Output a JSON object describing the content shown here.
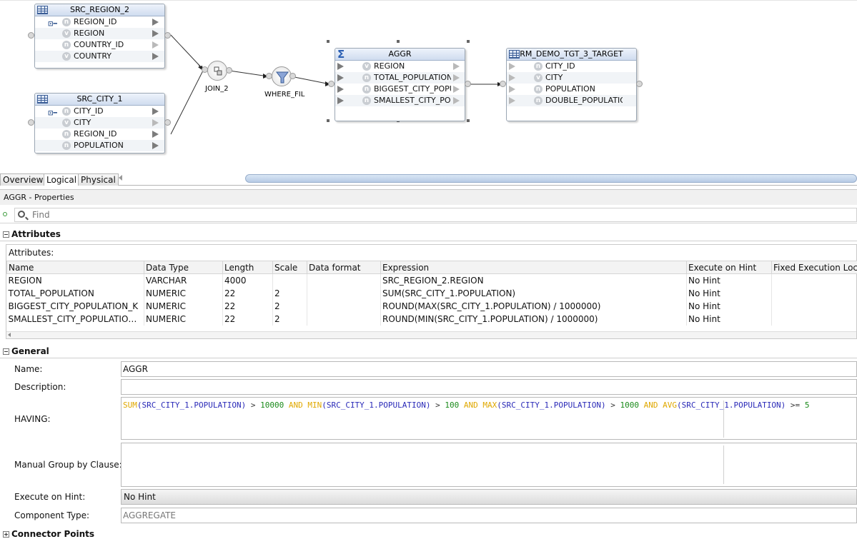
{
  "diagram": {
    "src_region": {
      "title": "SRC_REGION_2",
      "attrs": [
        {
          "name": "REGION_ID",
          "type_glyph": "n",
          "key": true,
          "arrow": "filled"
        },
        {
          "name": "REGION",
          "type_glyph": "v",
          "key": false,
          "arrow": "filled"
        },
        {
          "name": "COUNTRY_ID",
          "type_glyph": "n",
          "key": false,
          "arrow": "hollow"
        },
        {
          "name": "COUNTRY",
          "type_glyph": "v",
          "key": false,
          "arrow": "filled"
        }
      ]
    },
    "src_city": {
      "title": "SRC_CITY_1",
      "attrs": [
        {
          "name": "CITY_ID",
          "type_glyph": "n",
          "key": true,
          "arrow": "filled"
        },
        {
          "name": "CITY",
          "type_glyph": "v",
          "key": false,
          "arrow": "hollow"
        },
        {
          "name": "REGION_ID",
          "type_glyph": "n",
          "key": false,
          "arrow": "filled"
        },
        {
          "name": "POPULATION",
          "type_glyph": "n",
          "key": false,
          "arrow": "filled"
        }
      ]
    },
    "join": {
      "label": "JOIN_2"
    },
    "filter": {
      "label": "WHERE_FIL"
    },
    "aggr": {
      "title": "AGGR",
      "attrs": [
        {
          "name": "REGION",
          "type_glyph": "v"
        },
        {
          "name": "TOTAL_POPULATION",
          "type_glyph": "n"
        },
        {
          "name": "BIGGEST_CITY_POPU",
          "type_glyph": "n"
        },
        {
          "name": "SMALLEST_CITY_POP",
          "type_glyph": "n"
        }
      ]
    },
    "target": {
      "title": "RM_DEMO_TGT_3_TARGET",
      "attrs": [
        {
          "name": "CITY_ID",
          "type_glyph": "n"
        },
        {
          "name": "CITY",
          "type_glyph": "v"
        },
        {
          "name": "POPULATION",
          "type_glyph": "n"
        },
        {
          "name": "DOUBLE_POPULATION",
          "type_glyph": "n"
        }
      ]
    }
  },
  "tabs": [
    {
      "label": "Overview",
      "active": false
    },
    {
      "label": "Logical",
      "active": true
    },
    {
      "label": "Physical",
      "active": false
    }
  ],
  "properties": {
    "title": "AGGR - Properties",
    "find_placeholder": "Find"
  },
  "attributes_section": {
    "header": "Attributes",
    "caption": "Attributes:",
    "columns": [
      "Name",
      "Data Type",
      "Length",
      "Scale",
      "Data format",
      "Expression",
      "Execute on Hint",
      "Fixed Execution Loca"
    ],
    "rows": [
      [
        "REGION",
        "VARCHAR",
        "4000",
        "",
        "",
        "SRC_REGION_2.REGION",
        "No Hint",
        ""
      ],
      [
        "TOTAL_POPULATION",
        "NUMERIC",
        "22",
        "2",
        "",
        "SUM(SRC_CITY_1.POPULATION)",
        "No Hint",
        ""
      ],
      [
        "BIGGEST_CITY_POPULATION_K",
        "NUMERIC",
        "22",
        "2",
        "",
        "ROUND(MAX(SRC_CITY_1.POPULATION) / 1000000)",
        "No Hint",
        ""
      ],
      [
        "SMALLEST_CITY_POPULATION...",
        "NUMERIC",
        "22",
        "2",
        "",
        "ROUND(MIN(SRC_CITY_1.POPULATION) / 1000000)",
        "No Hint",
        ""
      ]
    ]
  },
  "general_section": {
    "header": "General",
    "name_label": "Name:",
    "name_value": "AGGR",
    "description_label": "Description:",
    "description_value": "",
    "having_label": "HAVING:",
    "having_tokens": [
      {
        "t": "SUM",
        "c": "kw"
      },
      {
        "t": "(SRC_CITY_1.POPULATION)",
        "c": "id"
      },
      {
        "t": " > ",
        "c": "op"
      },
      {
        "t": "10000",
        "c": "num"
      },
      {
        "t": " AND ",
        "c": "kw"
      },
      {
        "t": "MIN",
        "c": "kw"
      },
      {
        "t": "(SRC_CITY_1.POPULATION)",
        "c": "id"
      },
      {
        "t": " > ",
        "c": "op"
      },
      {
        "t": "100",
        "c": "num"
      },
      {
        "t": " AND ",
        "c": "kw"
      },
      {
        "t": "MAX",
        "c": "kw"
      },
      {
        "t": "(SRC_CITY_1.POPULATION)",
        "c": "id"
      },
      {
        "t": " > ",
        "c": "op"
      },
      {
        "t": "1000",
        "c": "num"
      },
      {
        "t": " AND ",
        "c": "kw"
      },
      {
        "t": "AVG",
        "c": "kw"
      },
      {
        "t": "(SRC_CITY_1.POPULATION)",
        "c": "id"
      },
      {
        "t": " >= ",
        "c": "op"
      },
      {
        "t": "5",
        "c": "num"
      }
    ],
    "group_by_label": "Manual Group by Clause:",
    "group_by_value": "",
    "hint_label": "Execute on Hint:",
    "hint_value": "No Hint",
    "component_type_label": "Component Type:",
    "component_type_value": "AGGREGATE"
  },
  "connector_section": {
    "header": "Connector Points"
  }
}
